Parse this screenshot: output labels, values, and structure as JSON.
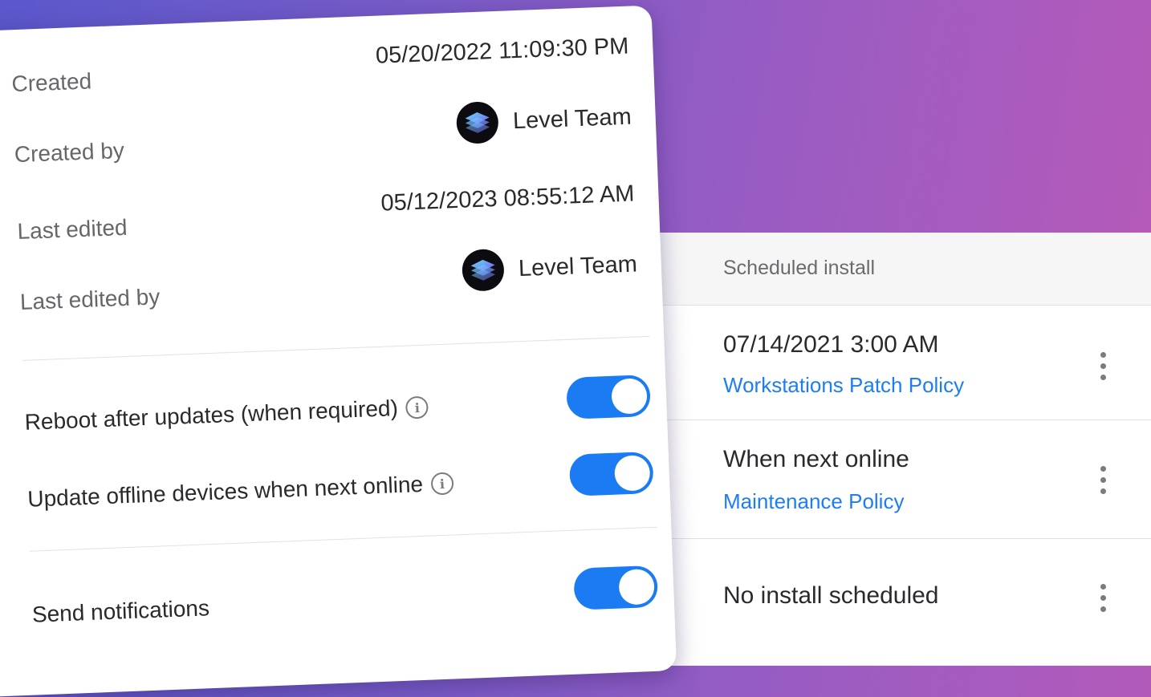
{
  "accent_color": "#1a7bf2",
  "link_color": "#1e7df0",
  "details": {
    "created_label": "Created",
    "created_value": "05/20/2022 11:09:30 PM",
    "created_by_label": "Created by",
    "created_by_user": "Level Team",
    "last_edited_label": "Last edited",
    "last_edited_value": "05/12/2023 08:55:12 AM",
    "last_edited_by_label": "Last edited by",
    "last_edited_by_user": "Level Team",
    "avatar_icon": "level-logo-icon"
  },
  "settings": {
    "reboot_label": "Reboot after updates (when required)",
    "reboot_on": true,
    "offline_label": "Update offline devices when next online",
    "offline_on": true,
    "notifications_label": "Send notifications",
    "notifications_on": true,
    "info_icon": "info-icon"
  },
  "table": {
    "column_header": "Scheduled install",
    "rows": [
      {
        "primary": "07/14/2021 3:00 AM",
        "policy": "Workstations Patch Policy"
      },
      {
        "primary": "When next online",
        "policy": "Maintenance Policy"
      },
      {
        "primary": "No install scheduled",
        "policy": ""
      }
    ],
    "row_menu_icon": "kebab-menu-icon"
  }
}
